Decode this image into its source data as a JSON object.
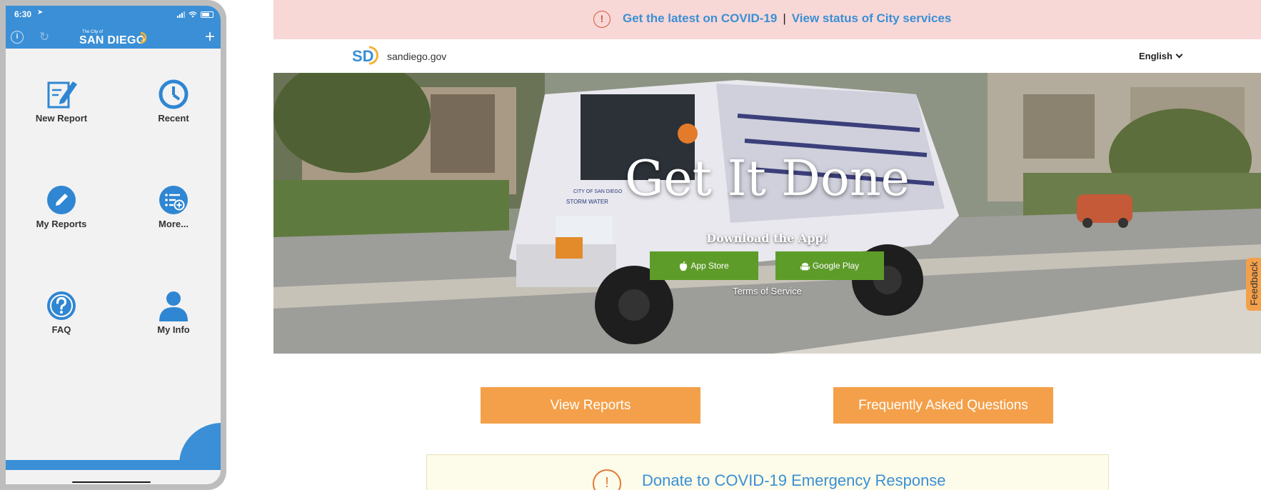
{
  "phone": {
    "status_time": "6:30",
    "app_logo_small": "The City of",
    "app_logo_big": "SAN DIEGO",
    "menu": [
      {
        "label": "New Report",
        "icon": "new-report-icon"
      },
      {
        "label": "Recent",
        "icon": "clock-icon"
      },
      {
        "label": "My Reports",
        "icon": "pencil-circle-icon"
      },
      {
        "label": "More...",
        "icon": "list-add-icon"
      },
      {
        "label": "FAQ",
        "icon": "question-circle-icon"
      },
      {
        "label": "My Info",
        "icon": "user-icon"
      }
    ]
  },
  "banner": {
    "covid_link": "Get the latest on COVID-19",
    "separator": "|",
    "services_link": "View status of City services"
  },
  "header": {
    "logo_text": "SD",
    "site_name": "sandiego.gov",
    "language": "English"
  },
  "hero": {
    "title": "Get It Done",
    "subtitle": "Download the App!",
    "app_store": "App Store",
    "google_play": "Google Play",
    "terms": "Terms of Service",
    "truck_door_text": "CITY OF SAN DIEGO",
    "truck_side_text": "STORM WATER"
  },
  "feedback": "Feedback",
  "actions": {
    "view_reports": "View Reports",
    "faq": "Frequently Asked Questions"
  },
  "donate": {
    "text": "Donate to COVID-19 Emergency Response"
  },
  "colors": {
    "phone_blue": "#3a8fd6",
    "banner_bg": "#f8d7d7",
    "link_blue": "#3a90d4",
    "orange": "#f4a04a",
    "store_green": "#5e9c2a"
  }
}
